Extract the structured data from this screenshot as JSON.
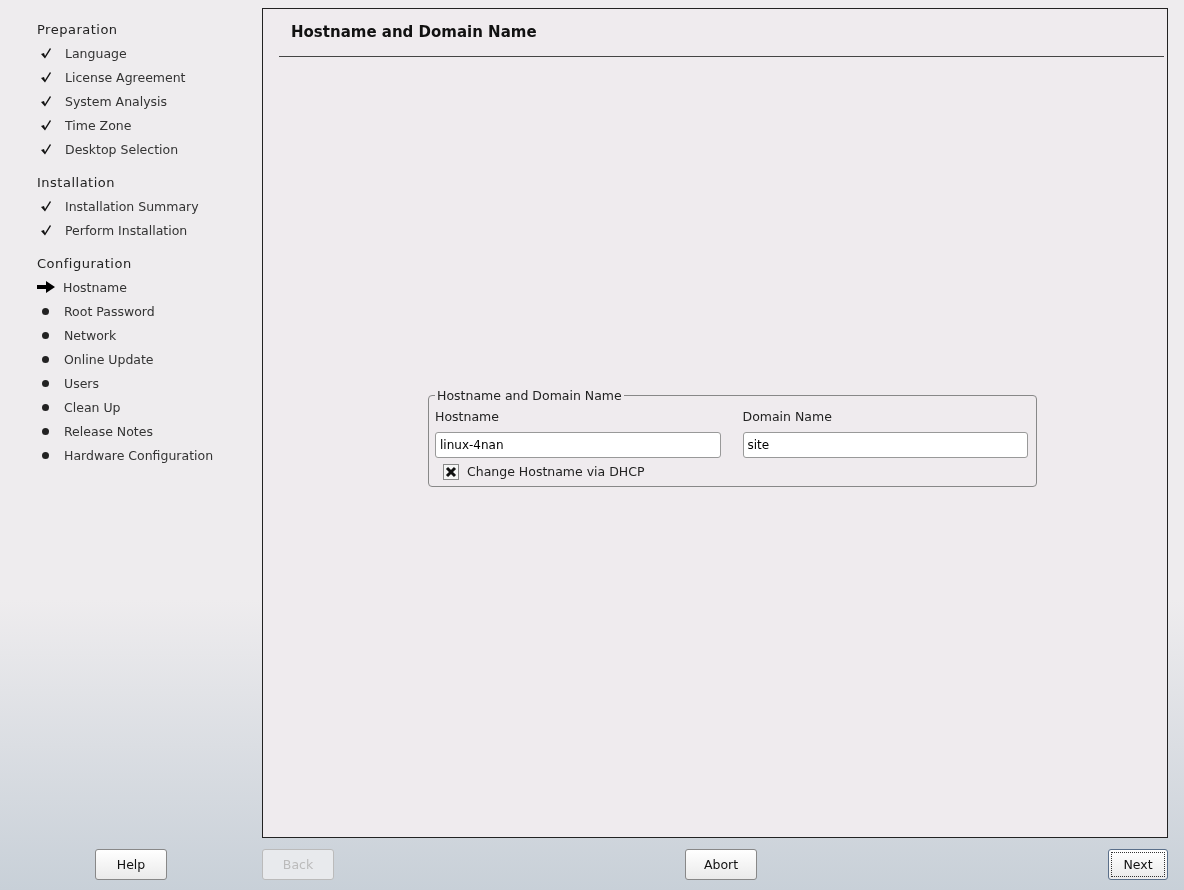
{
  "sidebar": {
    "sections": [
      {
        "title": "Preparation",
        "steps": [
          {
            "label": "Language",
            "kind": "done"
          },
          {
            "label": "License Agreement",
            "kind": "done"
          },
          {
            "label": "System Analysis",
            "kind": "done"
          },
          {
            "label": "Time Zone",
            "kind": "done"
          },
          {
            "label": "Desktop Selection",
            "kind": "done"
          }
        ]
      },
      {
        "title": "Installation",
        "steps": [
          {
            "label": "Installation Summary",
            "kind": "done"
          },
          {
            "label": "Perform Installation",
            "kind": "done"
          }
        ]
      },
      {
        "title": "Configuration",
        "steps": [
          {
            "label": "Hostname",
            "kind": "current"
          },
          {
            "label": "Root Password",
            "kind": "pending"
          },
          {
            "label": "Network",
            "kind": "pending"
          },
          {
            "label": "Online Update",
            "kind": "pending"
          },
          {
            "label": "Users",
            "kind": "pending"
          },
          {
            "label": "Clean Up",
            "kind": "pending"
          },
          {
            "label": "Release Notes",
            "kind": "pending"
          },
          {
            "label": "Hardware Configuration",
            "kind": "pending"
          }
        ]
      }
    ]
  },
  "page_title": "Hostname and Domain Name",
  "group": {
    "title": "Hostname and Domain Name",
    "fields": [
      {
        "label": "Hostname",
        "value": "linux-4nan"
      },
      {
        "label": "Domain Name",
        "value": "site"
      }
    ],
    "checkbox": {
      "label": "Change Hostname via DHCP",
      "checked": true
    }
  },
  "buttons": [
    {
      "label": "Help",
      "kind": "help",
      "disabled": false
    },
    {
      "label": "Back",
      "kind": "back",
      "disabled": true
    },
    {
      "label": "Abort",
      "kind": "abort",
      "disabled": false
    },
    {
      "label": "Next",
      "kind": "next",
      "disabled": false
    }
  ]
}
